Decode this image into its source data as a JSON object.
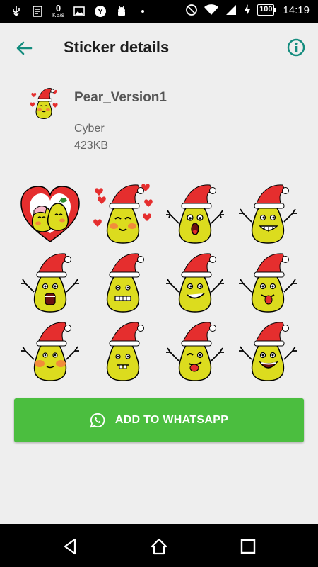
{
  "status_bar": {
    "speed_value": "0",
    "speed_unit": "KB/s",
    "battery": "100",
    "time": "14:19"
  },
  "app_bar": {
    "title": "Sticker details"
  },
  "pack": {
    "name": "Pear_Version1",
    "author": "Cyber",
    "size": "423KB"
  },
  "stickers": [
    {
      "icon": "pear-couple-heart-sticker"
    },
    {
      "icon": "pear-love-hearts-sticker"
    },
    {
      "icon": "pear-shocked-sticker"
    },
    {
      "icon": "pear-grin-sticker"
    },
    {
      "icon": "pear-scream-sticker"
    },
    {
      "icon": "pear-grimace-sticker"
    },
    {
      "icon": "pear-smirk-sticker"
    },
    {
      "icon": "pear-tongue-sticker"
    },
    {
      "icon": "pear-blush-sticker"
    },
    {
      "icon": "pear-teeth-sticker"
    },
    {
      "icon": "pear-wink-tongue-sticker"
    },
    {
      "icon": "pear-laugh-sticker"
    }
  ],
  "actions": {
    "add_label": "ADD TO WHATSAPP"
  },
  "colors": {
    "accent": "#138c7e",
    "button": "#4bbe3f",
    "pear": "#dcdc1e"
  }
}
